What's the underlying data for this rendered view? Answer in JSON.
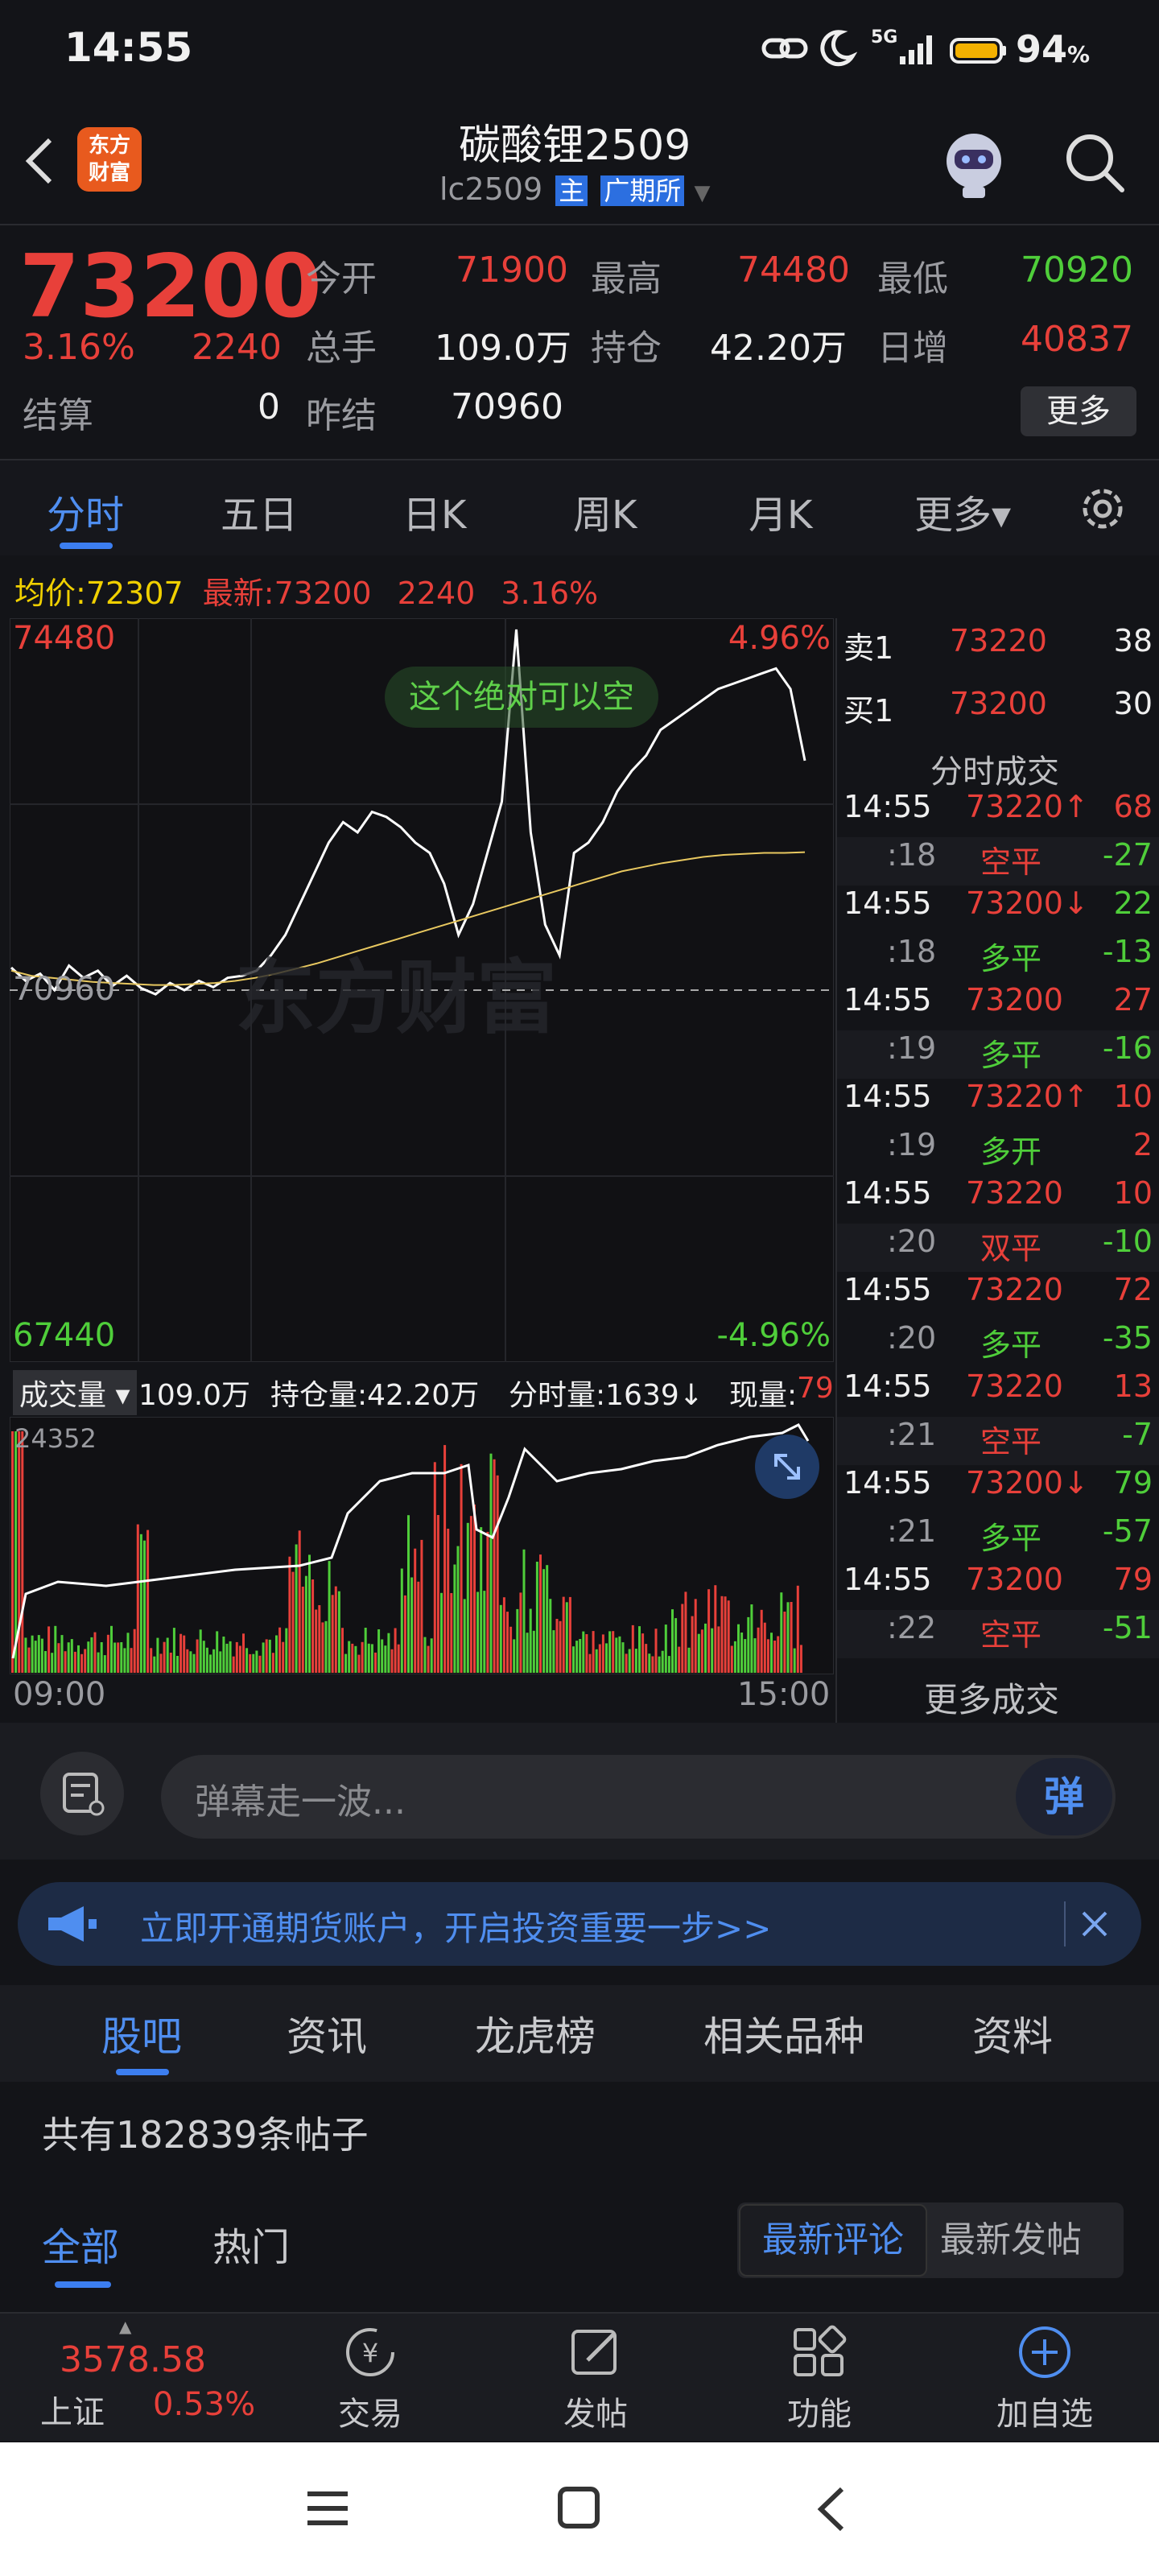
{
  "status_bar": {
    "time": "14:55",
    "battery": "94",
    "battery_unit": "%",
    "network": "5G"
  },
  "header": {
    "logo_line1": "东方",
    "logo_line2": "财富",
    "title": "碳酸锂2509",
    "code": "lc2509",
    "badge_main": "主",
    "badge_exchange": "广期所"
  },
  "quote": {
    "price": "73200",
    "change_pct": "3.16%",
    "change": "2240",
    "open_label": "今开",
    "open": "71900",
    "high_label": "最高",
    "high": "74480",
    "low_label": "最低",
    "low": "70920",
    "volume_label": "总手",
    "volume": "109.0万",
    "oi_label": "持仓",
    "oi": "42.20万",
    "daily_inc_label": "日增",
    "daily_inc": "40837",
    "settle_label": "结算",
    "settle": "0",
    "prev_settle_label": "昨结",
    "prev_settle": "70960",
    "more": "更多"
  },
  "chart_tabs": [
    {
      "label": "分时"
    },
    {
      "label": "五日"
    },
    {
      "label": "日K"
    },
    {
      "label": "周K"
    },
    {
      "label": "月K"
    },
    {
      "label": "更多▾"
    }
  ],
  "info_line": {
    "avg_label": "均价:",
    "avg": "72307",
    "latest_label": "最新:",
    "latest": "73200",
    "change": "2240",
    "pct": "3.16%"
  },
  "chart": {
    "top_price": "74480",
    "top_pct": "4.96%",
    "base_price": "70960",
    "bottom_price": "67440",
    "bottom_pct": "-4.96%",
    "comment": "这个绝对可以空",
    "watermark": "东方财富",
    "vol_max": "24352",
    "time_start": "09:00",
    "time_end": "15:00",
    "vol_selector": "成交量",
    "vol_total": "109.0万",
    "oi_text": "持仓量:42.20万",
    "tick_vol": "分时量:1639↓",
    "now_vol_label": "现量:",
    "now_vol": "79"
  },
  "chart_data": {
    "type": "line",
    "ylim": [
      67440,
      74480
    ],
    "series": [
      {
        "values": [
          71180,
          71050,
          71120,
          70960,
          71200,
          71080,
          71150,
          71000,
          71100,
          70980,
          70920,
          71030,
          70960,
          71050,
          70990,
          71080,
          71100,
          71150,
          71300,
          71500,
          71800,
          72100,
          72400,
          72600,
          72500,
          72700,
          72650,
          72550,
          72400,
          72300,
          72000,
          71500,
          71800,
          72300,
          72800,
          74480,
          72500,
          71600,
          71300,
          72300,
          72400,
          72600,
          72900,
          73100,
          73250,
          73500,
          73600,
          73700,
          73800,
          73900,
          73950,
          74000,
          74050,
          74100,
          73900,
          73200
        ]
      },
      {
        "values": [
          71150,
          71100,
          71080,
          71060,
          71040,
          71030,
          71020,
          71010,
          71010,
          71020,
          71030,
          71050,
          71080,
          71120,
          71170,
          71220,
          71280,
          71340,
          71400,
          71460,
          71520,
          71580,
          71640,
          71700,
          71760,
          71820,
          71880,
          71940,
          72000,
          72060,
          72120,
          72160,
          72200,
          72230,
          72260,
          72280,
          72290,
          72300,
          72300,
          72307
        ]
      }
    ],
    "volume_max": 24352
  },
  "trades": {
    "ask_label": "卖1",
    "ask_price": "73220",
    "ask_vol": "38",
    "bid_label": "买1",
    "bid_price": "73200",
    "bid_vol": "30",
    "title": "分时成交",
    "more": "更多成交",
    "rows": [
      {
        "time": "14:55",
        "price": "73220↑",
        "vol": "68",
        "sec": ":18",
        "kind": "空平",
        "oi": "-27"
      },
      {
        "time": "14:55",
        "price": "73200↓",
        "vol": "22",
        "sec": ":18",
        "kind": "多平",
        "oi": "-13"
      },
      {
        "time": "14:55",
        "price": "73200",
        "vol": "27",
        "sec": ":19",
        "kind": "多平",
        "oi": "-16"
      },
      {
        "time": "14:55",
        "price": "73220↑",
        "vol": "10",
        "sec": ":19",
        "kind": "多开",
        "oi": "2"
      },
      {
        "time": "14:55",
        "price": "73220",
        "vol": "10",
        "sec": ":20",
        "kind": "双平",
        "oi": "-10"
      },
      {
        "time": "14:55",
        "price": "73220",
        "vol": "72",
        "sec": ":20",
        "kind": "多平",
        "oi": "-35"
      },
      {
        "time": "14:55",
        "price": "73220",
        "vol": "13",
        "sec": ":21",
        "kind": "空平",
        "oi": "-7"
      },
      {
        "time": "14:55",
        "price": "73200↓",
        "vol": "79",
        "sec": ":21",
        "kind": "多平",
        "oi": "-57"
      },
      {
        "time": "14:55",
        "price": "73200",
        "vol": "79",
        "sec": ":22",
        "kind": "空平",
        "oi": "-51"
      }
    ]
  },
  "danmaku": {
    "placeholder": "弹幕走一波...",
    "send": "弹"
  },
  "banner": {
    "text": "立即开通期货账户，开启投资重要一步>>"
  },
  "section_tabs": [
    {
      "label": "股吧"
    },
    {
      "label": "资讯"
    },
    {
      "label": "龙虎榜"
    },
    {
      "label": "相关品种"
    },
    {
      "label": "资料"
    }
  ],
  "posts": {
    "count_text": "共有182839条帖子",
    "filter_all": "全部",
    "filter_hot": "热门",
    "sort_latest_comment": "最新评论",
    "sort_latest_post": "最新发帖"
  },
  "bottom_nav": {
    "index_value": "3578.58",
    "index_name": "上证",
    "index_pct": "0.53%",
    "trade": "交易",
    "post": "发帖",
    "func": "功能",
    "add": "加自选"
  }
}
